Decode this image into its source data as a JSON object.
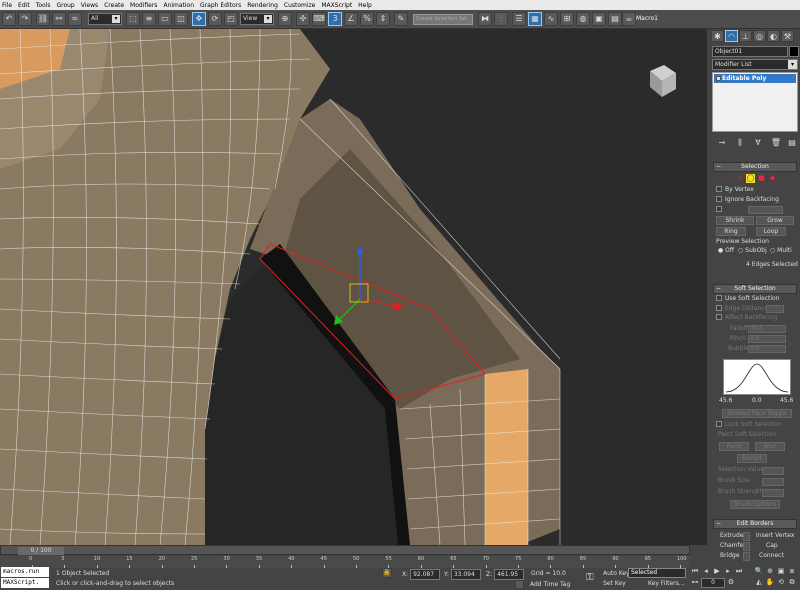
{
  "menu": [
    "File",
    "Edit",
    "Tools",
    "Group",
    "Views",
    "Create",
    "Modifiers",
    "Animation",
    "Graph Editors",
    "Rendering",
    "Customize",
    "MAXScript",
    "Help"
  ],
  "toolbar": {
    "filter_value": "All",
    "refcoord_value": "View",
    "named_selection_placeholder": "Create Selection Set",
    "macro_label": "Macro1"
  },
  "command_panel": {
    "object_name": "Object01",
    "modifier_list": "Modifier List",
    "stack_item": "Editable Poly",
    "selection": {
      "title": "Selection",
      "by_vertex": "By Vertex",
      "ignore_backfacing": "Ignore Backfacing",
      "shrink": "Shrink",
      "grow": "Grow",
      "ring": "Ring",
      "loop": "Loop",
      "preview_title": "Preview Selection",
      "preview_off": "Off",
      "preview_subobj": "SubObj",
      "preview_multi": "Multi",
      "status": "4 Edges Selected"
    },
    "soft_selection": {
      "title": "Soft Selection",
      "use_soft": "Use Soft Selection",
      "edge_distance": "Edge Distance",
      "affect_backfacing": "Affect Backfacing",
      "falloff": "Falloff",
      "falloff_val": "45.6",
      "pinch": "Pinch",
      "pinch_val": "0.0",
      "bubble": "Bubble",
      "bubble_val": "0.0",
      "curve_min": "45.6",
      "curve_mid": "0.0",
      "curve_max": "45.6",
      "shaded_face": "Shaded Face Toggle",
      "lock_soft": "Lock Soft Selection",
      "paint_title": "Paint Soft Selection",
      "paint": "Paint",
      "blur": "Blur",
      "revert": "Revert",
      "selection_value": "Selection Value",
      "brush_size": "Brush Size",
      "brush_strength": "Brush Strength",
      "brush_options": "Brush Options"
    },
    "edit_borders": {
      "title": "Edit Borders",
      "extrude": "Extrude",
      "insert_vertex": "Insert Vertex",
      "chamfer": "Chamfer",
      "cap": "Cap",
      "bridge": "Bridge",
      "connect": "Connect"
    }
  },
  "timeline": {
    "frame_display": "0 / 100",
    "ticks": [
      "0",
      "5",
      "10",
      "15",
      "20",
      "25",
      "30",
      "35",
      "40",
      "45",
      "50",
      "55",
      "60",
      "65",
      "70",
      "75",
      "80",
      "85",
      "90",
      "95",
      "100"
    ]
  },
  "status": {
    "listener1": "macros.run",
    "listener2": "MAXScript.",
    "objects_selected": "1 Object Selected",
    "prompt": "Click or click-and-drag to select objects",
    "x_label": "X:",
    "x_value": "92.087",
    "y_label": "Y:",
    "y_value": "33.094",
    "z_label": "Z:",
    "z_value": "461.95",
    "grid": "Grid = 10.0",
    "add_time_tag": "Add Time Tag",
    "auto_key": "Auto Key",
    "set_key": "Set Key",
    "key_mode": "Selected",
    "key_filters": "Key Filters...",
    "frame_value": "0"
  },
  "colors": {
    "viewport_bg": "#2b2b2b",
    "mesh_face": "#8b7a62",
    "mesh_highlight": "#e6a867",
    "selected_edge": "#e02020",
    "stack_highlight": "#3478c8"
  }
}
